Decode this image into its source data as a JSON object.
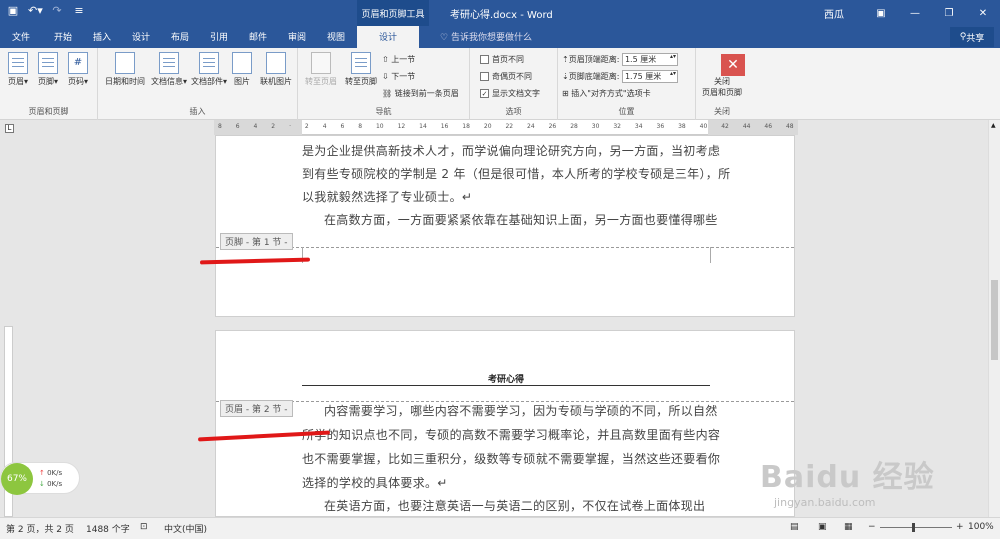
{
  "titlebar": {
    "context_tool": "页眉和页脚工具",
    "doc_title": "考研心得.docx - Word",
    "user": "西瓜",
    "quick_access": [
      "save-icon",
      "undo-icon",
      "redo-icon",
      "customize-icon"
    ]
  },
  "tabs": [
    "文件",
    "开始",
    "插入",
    "设计",
    "布局",
    "引用",
    "邮件",
    "审阅",
    "视图",
    "设计"
  ],
  "active_tab": "设计",
  "tell_me": "告诉我你想要做什么",
  "share": "共享",
  "ribbon": {
    "group_hf": {
      "label": "页眉和页脚",
      "buttons": [
        "页眉",
        "页脚",
        "页码"
      ]
    },
    "group_insert": {
      "label": "插入",
      "buttons": [
        "日期和时间",
        "文档信息",
        "文档部件",
        "图片",
        "联机图片"
      ]
    },
    "group_nav": {
      "label": "导航",
      "buttons": [
        "转至页眉",
        "转至页脚"
      ],
      "small": [
        "上一节",
        "下一节",
        "链接到前一条页眉"
      ]
    },
    "group_options": {
      "label": "选项",
      "items": [
        {
          "label": "首页不同",
          "checked": false
        },
        {
          "label": "奇偶页不同",
          "checked": false
        },
        {
          "label": "显示文档文字",
          "checked": true
        }
      ]
    },
    "group_position": {
      "label": "位置",
      "header_label": "页眉顶端距离:",
      "header_value": "1.5 厘米",
      "footer_label": "页脚底端距离:",
      "footer_value": "1.75 厘米",
      "align_tab": "插入\"对齐方式\"选项卡"
    },
    "group_close": {
      "label": "关闭",
      "button": "关闭\n页眉和页脚"
    }
  },
  "ruler": {
    "marks": [
      "8",
      "6",
      "4",
      "2",
      "",
      "2",
      "4",
      "6",
      "8",
      "10",
      "12",
      "14",
      "16",
      "18",
      "20",
      "22",
      "24",
      "26",
      "28",
      "30",
      "32",
      "34",
      "36",
      "38",
      "40",
      "42",
      "44",
      "46",
      "48"
    ]
  },
  "page1": {
    "lines": [
      "是为企业提供高新技术人才，而学说偏向理论研究方向，另一方面，当初考虑",
      "到有些专硕院校的学制是 2 年（但是很可惜，本人所考的学校专硕是三年），所",
      "以我就毅然选择了专业硕士。↵",
      "在高数方面，一方面要紧紧依靠在基础知识上面，另一方面也要懂得哪些"
    ],
    "footer_tag": "页脚 - 第 1 节 -"
  },
  "page2": {
    "header_title": "考研心得",
    "header_tag": "页眉 - 第 2 节 -",
    "lines": [
      "内容需要学习，哪些内容不需要学习，因为专硕与学硕的不同，所以自然",
      "所学的知识点也不同，专硕的高数不需要学习概率论，并且高数里面有些内容",
      "也不需要掌握，比如三重积分，级数等专硕就不需要掌握，当然这些还要看你",
      "选择的学校的具体要求。↵",
      "在英语方面，也要注意英语一与英语二的区别，不仅在试卷上面体现出"
    ]
  },
  "status": {
    "page": "第 2 页，共 2 页",
    "words": "1488 个字",
    "lang": "中文(中国)",
    "zoom": "100%"
  },
  "net_widget": {
    "percent": "67%",
    "up": "0K/s",
    "down": "0K/s"
  },
  "watermark": {
    "brand": "Baidu 经验",
    "url": "jingyan.baidu.com"
  }
}
